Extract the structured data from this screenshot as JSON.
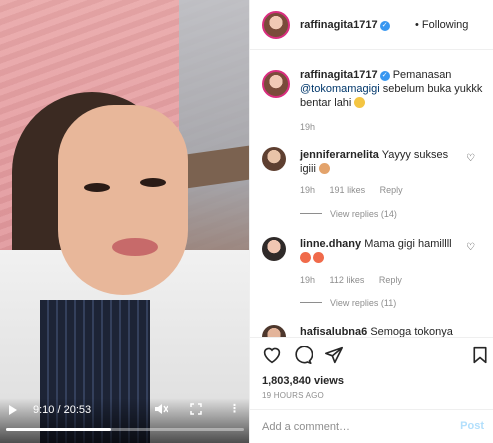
{
  "video": {
    "current_time": "9:10",
    "duration": "20:53",
    "time_label": "9:10 / 20:53",
    "progress_fraction": 0.44,
    "icons": [
      "play-icon",
      "mute-icon",
      "fullscreen-icon",
      "more-icon"
    ]
  },
  "header": {
    "username": "raffinagita1717",
    "separator": "•",
    "follow_label": "Following",
    "more_label": "..."
  },
  "caption": {
    "username": "raffinagita1717",
    "text_before": "Pemanasan",
    "mention": "@tokomamagigi",
    "text_after": "sebelum buka yukkk bentar lahi",
    "time": "19h"
  },
  "comments": [
    {
      "username": "jenniferarnelita",
      "text": "Yayyy sukses igiii",
      "time": "19h",
      "likes": "191 likes",
      "reply": "Reply",
      "view_replies": "View replies (14)"
    },
    {
      "username": "linne.dhany",
      "text": "Mama gigi hamillll",
      "time": "19h",
      "likes": "112 likes",
      "reply": "Reply",
      "view_replies": "View replies (11)"
    },
    {
      "username": "hafisalubna6",
      "text": "Semoga tokonya"
    }
  ],
  "actions": {
    "views": "1,803,840 views",
    "date": "19 HOURS AGO"
  },
  "add_comment": {
    "placeholder": "Add a comment…",
    "post_label": "Post"
  },
  "colors": {
    "verified": "#3897f0",
    "link": "#00376b",
    "post_disabled": "#b2dffc",
    "story_ring": "#d92e7f"
  }
}
